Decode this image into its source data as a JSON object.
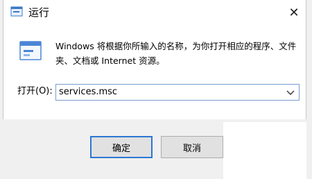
{
  "window": {
    "title": "运行",
    "close_glyph": "✕"
  },
  "dialog": {
    "description": "Windows 将根据你所输入的名称，为你打开相应的程序、文件夹、文档或 Internet 资源。",
    "open_label": "打开(O):",
    "open_value": "services.msc"
  },
  "buttons": {
    "ok_label": "确定",
    "cancel_label": "取消"
  },
  "icons": {
    "app": "run-app-icon",
    "run": "run-dialog-icon",
    "dropdown": "chevron-down-icon",
    "close": "close-icon"
  },
  "colors": {
    "focus_border": "#2b77d4",
    "input_border": "#7a9bd1",
    "footer_bg": "#f0f0f0"
  }
}
